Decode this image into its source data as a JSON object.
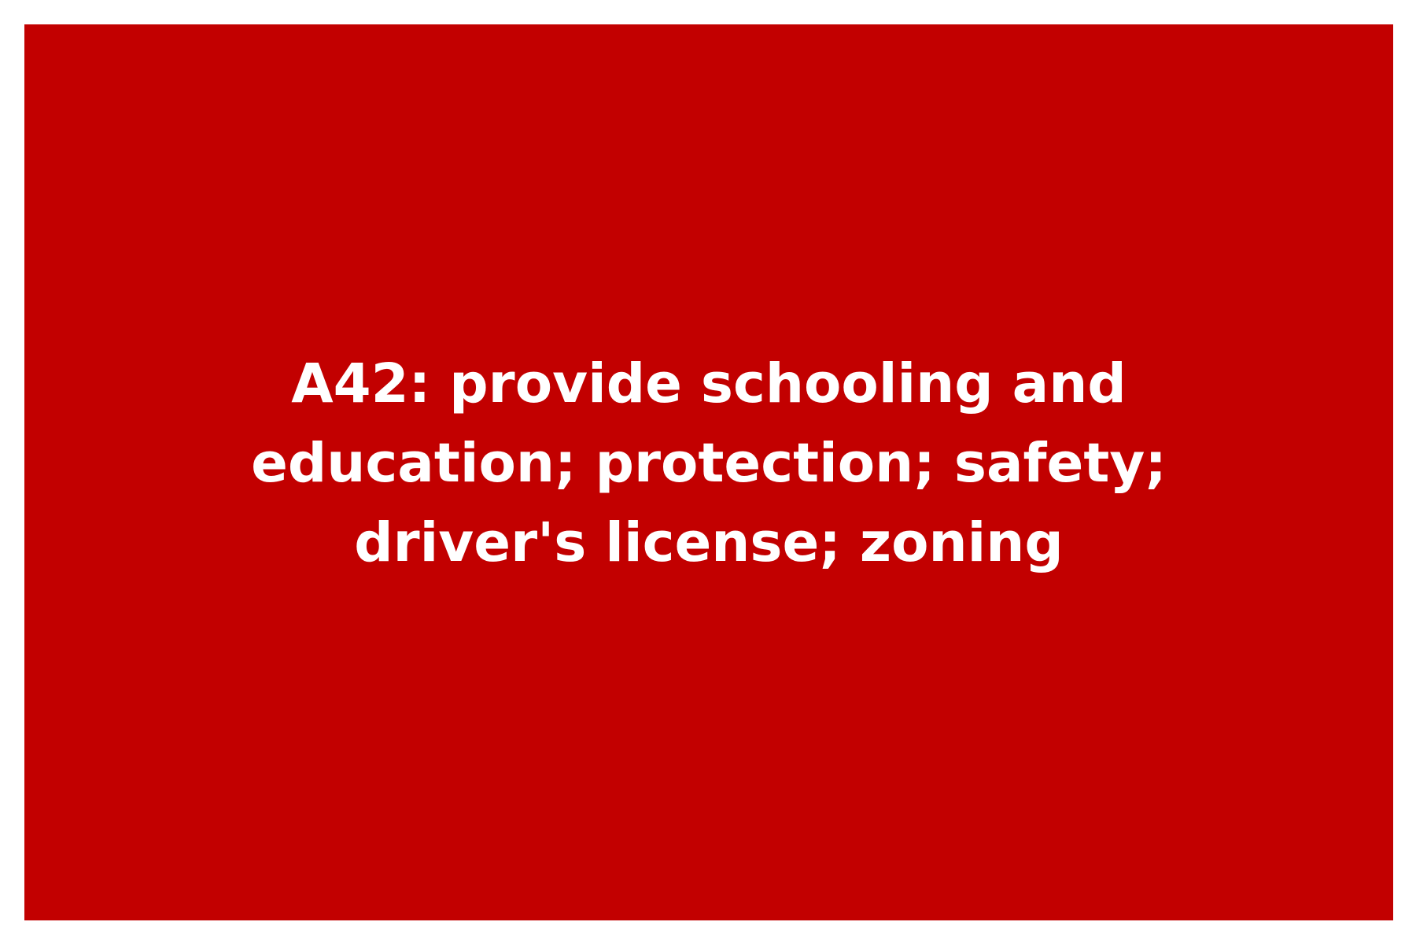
{
  "card": {
    "background_color": "#c20000",
    "text_color": "#ffffff",
    "lines": [
      "A42: provide schooling and",
      "education; protection; safety;",
      "driver's license; zoning"
    ]
  }
}
